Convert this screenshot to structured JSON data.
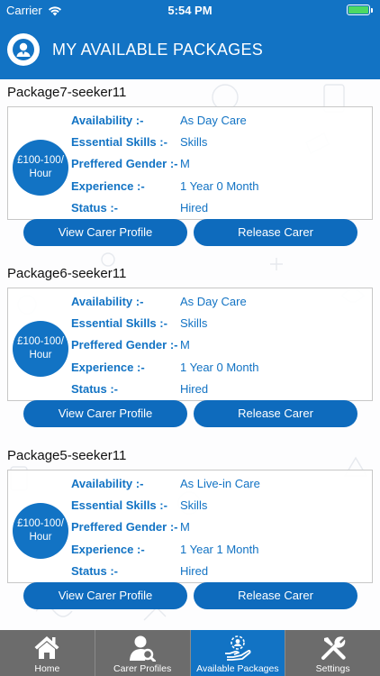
{
  "status": {
    "carrier": "Carrier",
    "time": "5:54 PM",
    "battery_level": 1.0
  },
  "header": {
    "title": "MY AVAILABLE PACKAGES",
    "avatar_icon": "carer-avatar-icon"
  },
  "labels": {
    "availability": "Availability :-",
    "skills": "Essential Skills :-",
    "gender": "Preffered Gender :-",
    "experience": "Experience :-",
    "status": "Status :-"
  },
  "packages": [
    {
      "title": "Package7-seeker11",
      "price": "£100-100/ Hour",
      "availability": "As Day Care",
      "skills": "Skills",
      "gender": "M",
      "experience": "1 Year 0 Month",
      "status": "Hired",
      "view_label": "View Carer Profile",
      "release_label": "Release Carer"
    },
    {
      "title": "Package6-seeker11",
      "price": "£100-100/ Hour",
      "availability": "As Day Care",
      "skills": "Skills",
      "gender": "M",
      "experience": "1 Year 0 Month",
      "status": "Hired",
      "view_label": "View Carer Profile",
      "release_label": "Release Carer"
    },
    {
      "title": "Package5-seeker11",
      "price": "£100-100/ Hour",
      "availability": "As Live-in Care",
      "skills": "Skills",
      "gender": "M",
      "experience": "1 Year 1 Month",
      "status": "Hired",
      "view_label": "View Carer Profile",
      "release_label": "Release Carer"
    }
  ],
  "tabs": [
    {
      "label": "Home",
      "icon": "home-icon",
      "active": false
    },
    {
      "label": "Carer Profiles",
      "icon": "carer-search-icon",
      "active": false
    },
    {
      "label": "Available Packages",
      "icon": "packages-icon",
      "active": true
    },
    {
      "label": "Settings",
      "icon": "settings-icon",
      "active": false
    }
  ],
  "colors": {
    "primary": "#1273c4",
    "button": "#0e6bbd",
    "tabbar": "#6c6c6c",
    "battery": "#4cd964"
  }
}
